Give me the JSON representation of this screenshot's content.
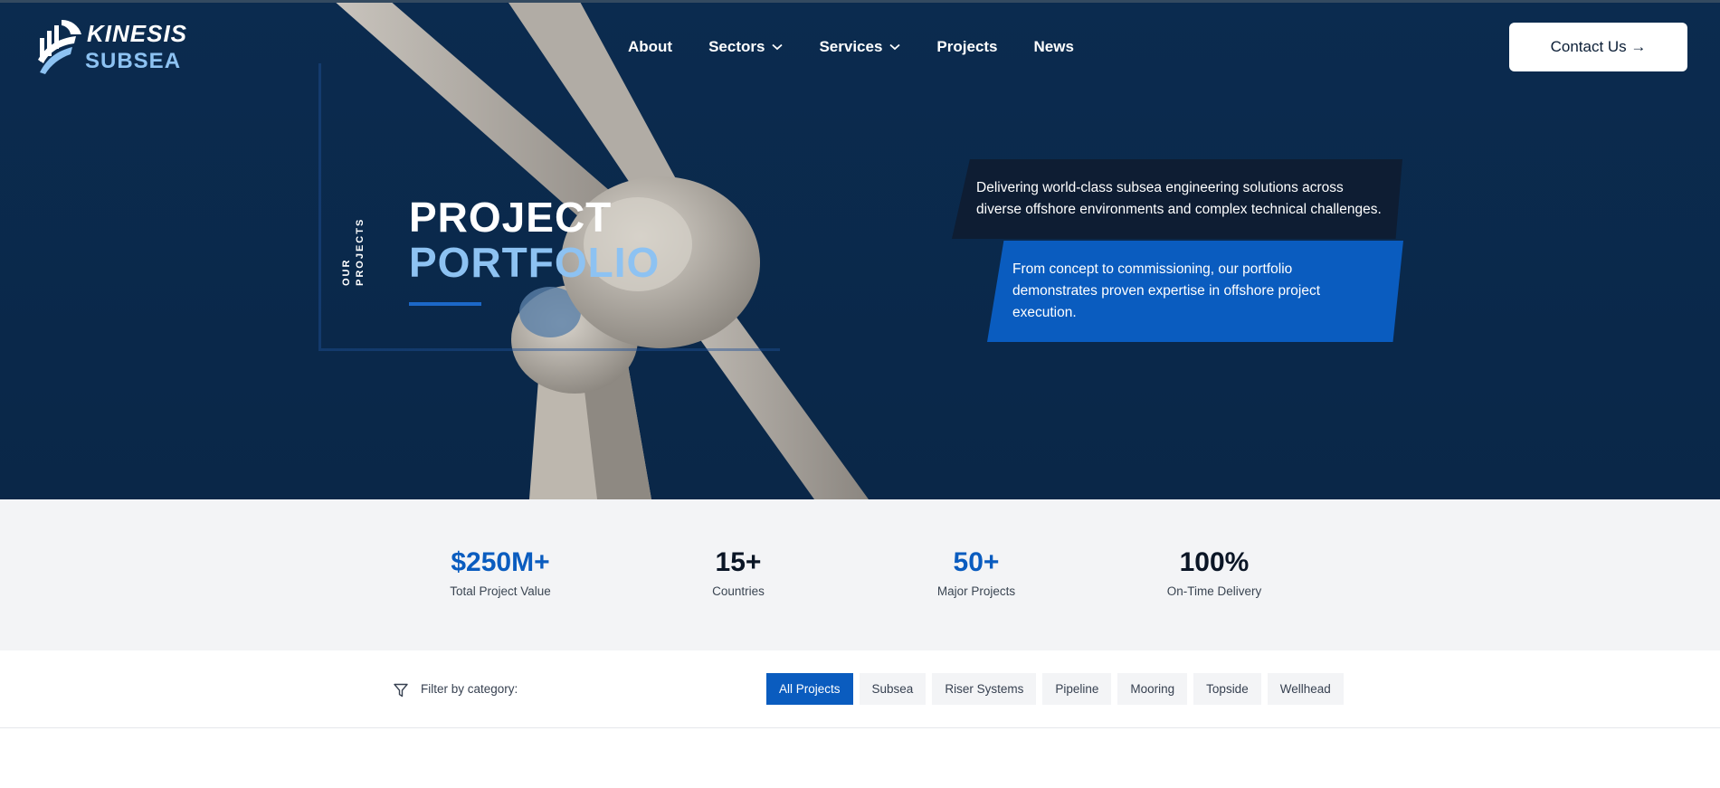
{
  "header": {
    "logo_line_1": "KINESIS",
    "logo_line_2": "SUBSEA",
    "nav": [
      {
        "label": "About",
        "has_dropdown": false
      },
      {
        "label": "Sectors",
        "has_dropdown": true
      },
      {
        "label": "Services",
        "has_dropdown": true
      },
      {
        "label": "Projects",
        "has_dropdown": false
      },
      {
        "label": "News",
        "has_dropdown": false
      }
    ],
    "contact_label": "Contact Us →"
  },
  "hero": {
    "side_label": "OUR PROJECTS",
    "title_line_1": "PROJECT",
    "title_line_2": "PORTFOLIO",
    "card_dark_text": "Delivering world-class subsea engineering solutions across diverse offshore environments and complex technical challenges.",
    "card_blue_text": "From concept to commissioning, our portfolio demonstrates proven expertise in offshore project execution."
  },
  "stats": [
    {
      "value": "$250M+",
      "label": "Total Project Value",
      "accent": "#0a5cbf"
    },
    {
      "value": "15+",
      "label": "Countries",
      "accent": "#0b1626"
    },
    {
      "value": "50+",
      "label": "Major Projects",
      "accent": "#0a5cbf"
    },
    {
      "value": "100%",
      "label": "On-Time Delivery",
      "accent": "#0b1626"
    }
  ],
  "filter": {
    "label": "Filter by category:",
    "categories": [
      "All Projects",
      "Subsea",
      "Riser Systems",
      "Pipeline",
      "Mooring",
      "Topside",
      "Wellhead"
    ],
    "active": "All Projects"
  },
  "colors": {
    "hero_bg": "#0a2a4d",
    "accent_blue": "#0a5cbf",
    "light_blue": "#8dc2f2",
    "stats_bg": "#f3f4f6"
  },
  "icons": [
    "logo-wave-icon",
    "chevron-down-icon",
    "filter-funnel-icon"
  ]
}
